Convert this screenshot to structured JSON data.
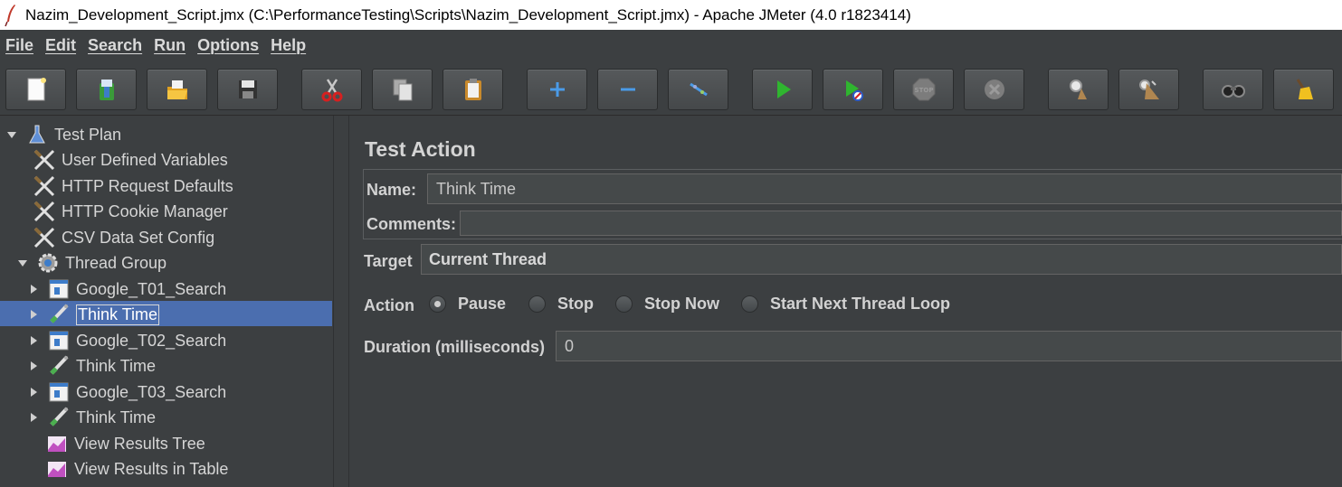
{
  "window": {
    "title": "Nazim_Development_Script.jmx (C:\\PerformanceTesting\\Scripts\\Nazim_Development_Script.jmx) - Apache JMeter (4.0 r1823414)"
  },
  "menu": {
    "items": [
      {
        "first": "F",
        "rest": "ile"
      },
      {
        "first": "E",
        "rest": "dit"
      },
      {
        "first": "S",
        "rest": "earch"
      },
      {
        "first": "R",
        "rest": "un"
      },
      {
        "first": "O",
        "rest": "ptions"
      },
      {
        "first": "H",
        "rest": "elp"
      }
    ]
  },
  "toolbar": {
    "buttons": [
      {
        "icon": "new-icon"
      },
      {
        "icon": "templates-icon"
      },
      {
        "icon": "open-icon"
      },
      {
        "icon": "save-icon"
      },
      {
        "icon": "cut-icon"
      },
      {
        "icon": "copy-icon"
      },
      {
        "icon": "paste-icon"
      },
      {
        "icon": "expand-icon"
      },
      {
        "icon": "collapse-icon"
      },
      {
        "icon": "toggle-icon"
      },
      {
        "icon": "start-icon"
      },
      {
        "icon": "start-no-pauses-icon"
      },
      {
        "icon": "stop-icon"
      },
      {
        "icon": "shutdown-icon"
      },
      {
        "icon": "clear-icon"
      },
      {
        "icon": "clear-all-icon"
      },
      {
        "icon": "search-icon"
      },
      {
        "icon": "reset-search-icon"
      }
    ],
    "stop_text": "STOP"
  },
  "tree": {
    "items": [
      {
        "label": "Test Plan",
        "icon": "test-plan-icon",
        "expander": "expanded"
      },
      {
        "label": "User Defined Variables",
        "icon": "config-element-icon"
      },
      {
        "label": "HTTP Request Defaults",
        "icon": "config-element-icon"
      },
      {
        "label": "HTTP Cookie Manager",
        "icon": "config-element-icon"
      },
      {
        "label": "CSV Data Set Config",
        "icon": "config-element-icon"
      },
      {
        "label": "Thread Group",
        "icon": "thread-group-icon",
        "expander": "expanded"
      },
      {
        "label": "Google_T01_Search",
        "icon": "transaction-controller-icon",
        "expander": "collapsed"
      },
      {
        "label": "Think Time",
        "icon": "test-action-icon",
        "expander": "collapsed",
        "selected": true
      },
      {
        "label": "Google_T02_Search",
        "icon": "transaction-controller-icon",
        "expander": "collapsed"
      },
      {
        "label": "Think Time",
        "icon": "test-action-icon",
        "expander": "collapsed"
      },
      {
        "label": "Google_T03_Search",
        "icon": "transaction-controller-icon",
        "expander": "collapsed"
      },
      {
        "label": "Think Time",
        "icon": "test-action-icon",
        "expander": "collapsed"
      },
      {
        "label": "View Results Tree",
        "icon": "listener-icon"
      },
      {
        "label": "View Results in Table",
        "icon": "listener-icon"
      }
    ]
  },
  "editor": {
    "title": "Test Action",
    "name_label": "Name:",
    "name_value": "Think Time",
    "comments_label": "Comments:",
    "comments_value": "",
    "target_label": "Target",
    "target_value": "Current Thread",
    "action_label": "Action",
    "actions": [
      {
        "label": "Pause",
        "selected": true
      },
      {
        "label": "Stop",
        "selected": false
      },
      {
        "label": "Stop Now",
        "selected": false
      },
      {
        "label": "Start Next Thread Loop",
        "selected": false
      }
    ],
    "duration_label": "Duration (milliseconds)",
    "duration_value": "0"
  },
  "colors": {
    "background": "#3c3f41",
    "selection": "#4b6eaf",
    "text": "#d6d6d6"
  }
}
